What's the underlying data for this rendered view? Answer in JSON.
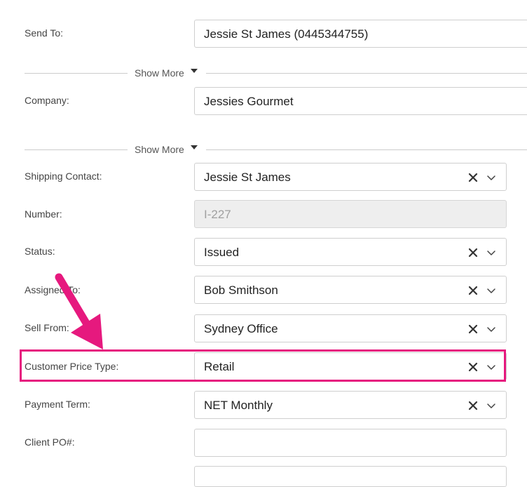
{
  "send_to": {
    "label": "Send To:",
    "value": "Jessie St James (0445344755)"
  },
  "show_more_1": {
    "label": "Show More"
  },
  "company": {
    "label": "Company:",
    "value": "Jessies Gourmet"
  },
  "show_more_2": {
    "label": "Show More"
  },
  "shipping_contact": {
    "label": "Shipping Contact:",
    "value": "Jessie St James"
  },
  "number": {
    "label": "Number:",
    "placeholder": "I-227"
  },
  "status": {
    "label": "Status:",
    "value": "Issued"
  },
  "assigned_to": {
    "label": "Assigned To:",
    "value": "Bob Smithson"
  },
  "sell_from": {
    "label": "Sell From:",
    "value": "Sydney Office"
  },
  "customer_price_type": {
    "label": "Customer Price Type:",
    "value": "Retail"
  },
  "payment_term": {
    "label": "Payment Term:",
    "value": "NET Monthly"
  },
  "client_po": {
    "label": "Client PO#:",
    "value": ""
  },
  "colors": {
    "highlight": "#e6197e",
    "arrow": "#e6197e",
    "border": "#cfcfcf",
    "disabled_bg": "#eeeeee"
  }
}
